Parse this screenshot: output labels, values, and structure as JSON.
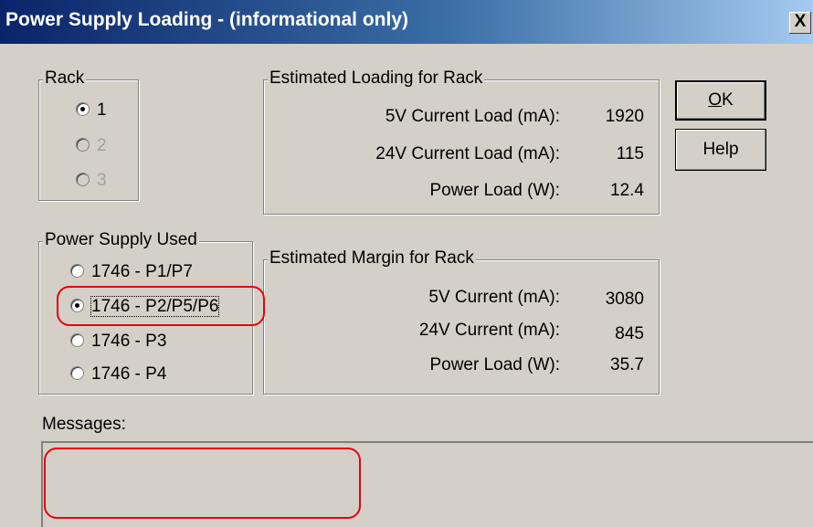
{
  "window": {
    "title": "Power Supply Loading  -  (informational only)",
    "close_label": "X"
  },
  "rack": {
    "legend": "Rack",
    "options": [
      {
        "label": "1",
        "checked": true,
        "enabled": true
      },
      {
        "label": "2",
        "checked": false,
        "enabled": false
      },
      {
        "label": "3",
        "checked": false,
        "enabled": false
      }
    ]
  },
  "power_supply": {
    "legend": "Power Supply Used",
    "options": [
      {
        "label": "1746 - P1/P7",
        "checked": false
      },
      {
        "label": "1746 - P2/P5/P6",
        "checked": true
      },
      {
        "label": "1746 - P3",
        "checked": false
      },
      {
        "label": "1746 - P4",
        "checked": false
      }
    ]
  },
  "loading": {
    "legend": "Estimated Loading for Rack",
    "rows": [
      {
        "label": "5V Current Load (mA):",
        "value": "1920"
      },
      {
        "label": "24V Current Load (mA):",
        "value": "115"
      },
      {
        "label": "Power Load (W):",
        "value": "12.4"
      }
    ]
  },
  "margin": {
    "legend": "Estimated Margin for Rack",
    "rows": [
      {
        "label": "5V Current (mA):",
        "value": "3080"
      },
      {
        "label": "24V Current (mA):",
        "value": "845"
      },
      {
        "label": "Power Load (W):",
        "value": "35.7"
      }
    ]
  },
  "buttons": {
    "ok_accel": "O",
    "ok_rest": "K",
    "help_label": "Help"
  },
  "messages": {
    "label": "Messages:"
  },
  "colors": {
    "annotation": "#e8000d",
    "dialog_bg": "#d4d0c8",
    "title_bar": "#0a246a"
  }
}
